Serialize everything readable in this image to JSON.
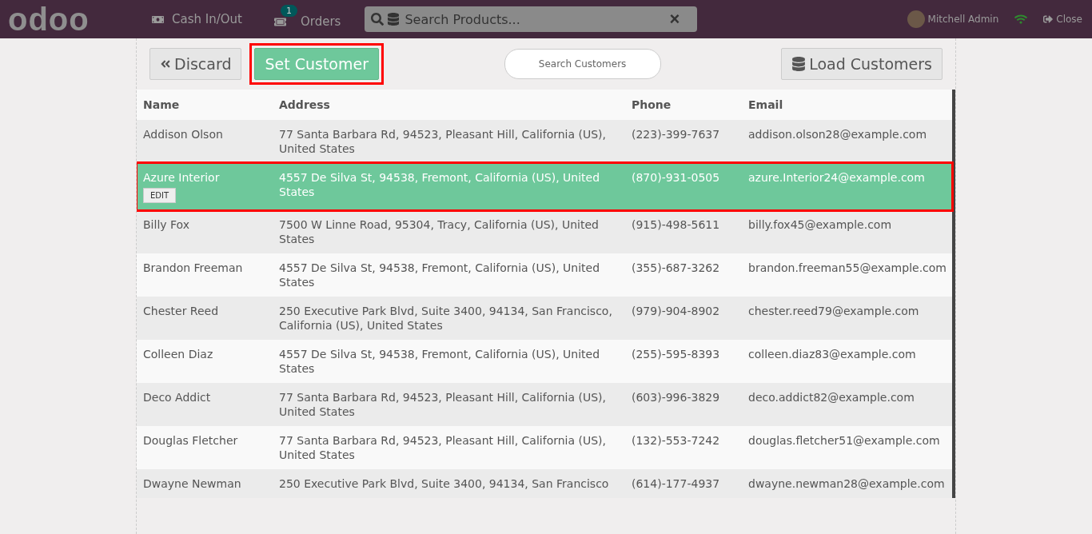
{
  "topbar": {
    "logo": "odoo",
    "cash_button": "Cash In/Out",
    "orders_button": "Orders",
    "orders_count": "1",
    "search": {
      "placeholder": "Search Products...",
      "clear": "×"
    },
    "user": "Mitchell Admin",
    "close": "Close"
  },
  "toolbar": {
    "discard": "Discard",
    "set_customer": {
      "label": "Set Customer",
      "highlighted": true
    },
    "search": {
      "placeholder": "Search Customers"
    },
    "load": "Load Customers"
  },
  "table": {
    "columns": [
      "Name",
      "Address",
      "Phone",
      "Email"
    ],
    "rows": [
      {
        "name": "Addison Olson",
        "address": "77 Santa Barbara Rd, 94523, Pleasant Hill, California (US), United States",
        "phone": "(223)-399-7637",
        "email": "addison.olson28@example.com",
        "selected": false
      },
      {
        "name": "Azure Interior",
        "address": "4557 De Silva St, 94538, Fremont, California (US), United States",
        "phone": "(870)-931-0505",
        "email": "azure.Interior24@example.com",
        "selected": true,
        "edit": "EDIT"
      },
      {
        "name": "Billy Fox",
        "address": "7500 W Linne Road, 95304, Tracy, California (US), United States",
        "phone": "(915)-498-5611",
        "email": "billy.fox45@example.com",
        "selected": false
      },
      {
        "name": "Brandon Freeman",
        "address": "4557 De Silva St, 94538, Fremont, California (US), United States",
        "phone": "(355)-687-3262",
        "email": "brandon.freeman55@example.com",
        "selected": false
      },
      {
        "name": "Chester Reed",
        "address": "250 Executive Park Blvd, Suite 3400, 94134, San Francisco, California (US), United States",
        "phone": "(979)-904-8902",
        "email": "chester.reed79@example.com",
        "selected": false
      },
      {
        "name": "Colleen Diaz",
        "address": "4557 De Silva St, 94538, Fremont, California (US), United States",
        "phone": "(255)-595-8393",
        "email": "colleen.diaz83@example.com",
        "selected": false
      },
      {
        "name": "Deco Addict",
        "address": "77 Santa Barbara Rd, 94523, Pleasant Hill, California (US), United States",
        "phone": "(603)-996-3829",
        "email": "deco.addict82@example.com",
        "selected": false
      },
      {
        "name": "Douglas Fletcher",
        "address": "77 Santa Barbara Rd, 94523, Pleasant Hill, California (US), United States",
        "phone": "(132)-553-7242",
        "email": "douglas.fletcher51@example.com",
        "selected": false
      },
      {
        "name": "Dwayne Newman",
        "address": "250 Executive Park Blvd, Suite 3400, 94134, San Francisco",
        "phone": "(614)-177-4937",
        "email": "dwayne.newman28@example.com",
        "selected": false
      }
    ]
  }
}
